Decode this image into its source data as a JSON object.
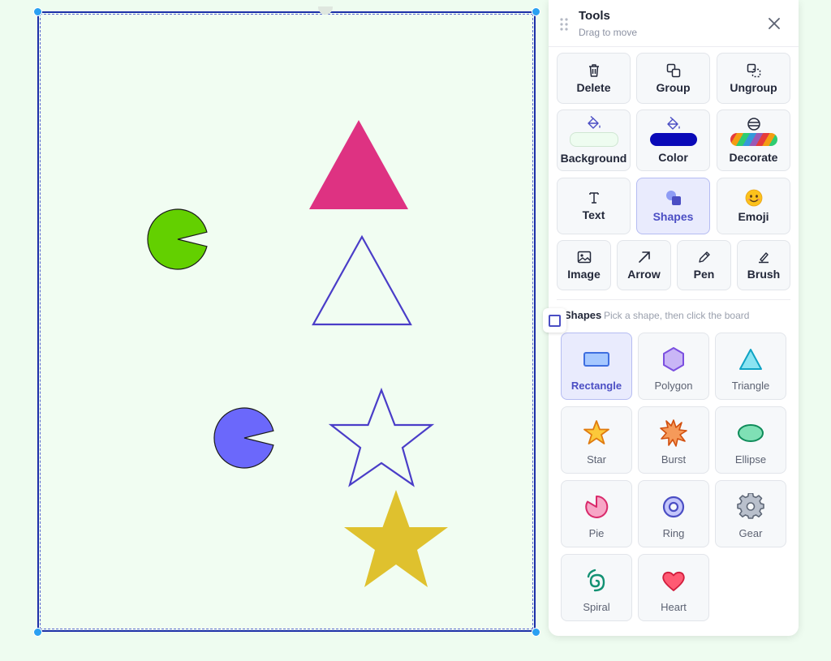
{
  "panel": {
    "title": "Tools",
    "subtitle": "Drag to move",
    "close_icon": "close-icon",
    "drag_icon": "drag-handle-icon"
  },
  "tools": {
    "delete": "Delete",
    "group": "Group",
    "ungroup": "Ungroup",
    "background": "Background",
    "color": "Color",
    "decorate": "Decorate",
    "text": "Text",
    "shapes": "Shapes",
    "emoji": "Emoji",
    "image": "Image",
    "arrow": "Arrow",
    "pen": "Pen",
    "brush": "Brush"
  },
  "swatches": {
    "background_color": "#eefcf0",
    "draw_color": "#0a0ab8",
    "decorate_gradient": [
      "#e63b3b",
      "#f39c12",
      "#2ecc71",
      "#3498db",
      "#9b59b6"
    ]
  },
  "shapes_section": {
    "title": "Shapes",
    "hint": "Pick a shape, then click the board",
    "selected": "Rectangle",
    "items": [
      {
        "label": "Rectangle",
        "icon": "rectangle-icon"
      },
      {
        "label": "Polygon",
        "icon": "polygon-icon"
      },
      {
        "label": "Triangle",
        "icon": "triangle-icon"
      },
      {
        "label": "Star",
        "icon": "star-icon"
      },
      {
        "label": "Burst",
        "icon": "burst-icon"
      },
      {
        "label": "Ellipse",
        "icon": "ellipse-icon"
      },
      {
        "label": "Pie",
        "icon": "pie-icon"
      },
      {
        "label": "Ring",
        "icon": "ring-icon"
      },
      {
        "label": "Gear",
        "icon": "gear-icon"
      },
      {
        "label": "Spiral",
        "icon": "spiral-icon"
      },
      {
        "label": "Heart",
        "icon": "heart-icon"
      }
    ]
  },
  "board": {
    "background": "#f1fdf2",
    "frame_color": "#1c2fa8",
    "shapes": [
      {
        "kind": "triangle",
        "fill": "#de3282",
        "stroke": "none"
      },
      {
        "kind": "pie",
        "fill": "#63d000",
        "stroke": "#1a1a1a"
      },
      {
        "kind": "triangle",
        "fill": "none",
        "stroke": "#4a3dc8"
      },
      {
        "kind": "pie",
        "fill": "#6b68fb",
        "stroke": "#1a1a1a"
      },
      {
        "kind": "star",
        "fill": "none",
        "stroke": "#4a3dc8"
      },
      {
        "kind": "star",
        "fill": "#dfc12e",
        "stroke": "none"
      }
    ]
  }
}
